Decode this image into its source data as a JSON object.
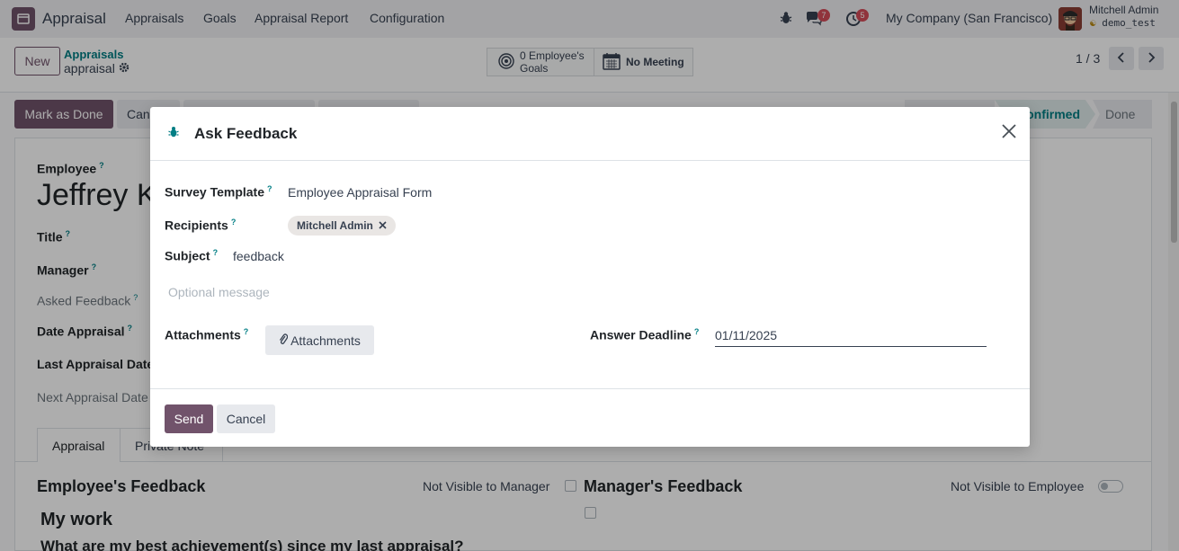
{
  "navbar": {
    "app_name": "Appraisal",
    "menu": [
      "Appraisals",
      "Goals",
      "Appraisal Report",
      "Configuration"
    ],
    "chat_badge": "7",
    "activity_badge": "5",
    "company": "My Company (San Francisco)",
    "user_name": "Mitchell Admin",
    "database": "demo_test"
  },
  "control_panel": {
    "new_label": "New",
    "breadcrumb_parent": "Appraisals",
    "breadcrumb_current": "appraisal",
    "goals_count": "0 Employee's",
    "goals_label": "Goals",
    "meeting_label": "No Meeting",
    "pager": "1 / 3"
  },
  "form": {
    "mark_done_label": "Mark as Done",
    "cancel_partial": "Can",
    "status_confirmed": "Confirmed",
    "status_done": "Done",
    "employee_label": "Employee",
    "employee_name": "Jeffrey K",
    "title_label": "Title",
    "manager_label": "Manager",
    "asked_feedback_label": "Asked Feedback",
    "date_appraisal_label": "Date Appraisal",
    "last_appraisal_label": "Last Appraisal Date",
    "next_appraisal_label": "Next Appraisal Date",
    "tabs": [
      "Appraisal",
      "Private Note"
    ],
    "employee_feedback_title": "Employee's Feedback",
    "not_visible_manager": "Not Visible to Manager",
    "manager_feedback_title": "Manager's Feedback",
    "not_visible_employee": "Not Visible to Employee",
    "my_work": "My work",
    "question": "What are my best achievement(s) since my last appraisal?"
  },
  "dialog": {
    "title": "Ask Feedback",
    "survey_template_label": "Survey Template",
    "survey_template_value": "Employee Appraisal Form",
    "recipients_label": "Recipients",
    "recipient_tag": "Mitchell Admin",
    "subject_label": "Subject",
    "subject_value": "feedback",
    "message_placeholder": "Optional message",
    "attachments_label": "Attachments",
    "attachments_button": "Attachments",
    "deadline_label": "Answer Deadline",
    "deadline_value": "01/11/2025",
    "send_label": "Send",
    "cancel_label": "Cancel"
  },
  "colors": {
    "primary": "#71536b",
    "link": "#017e84",
    "badge": "#d44c59"
  }
}
